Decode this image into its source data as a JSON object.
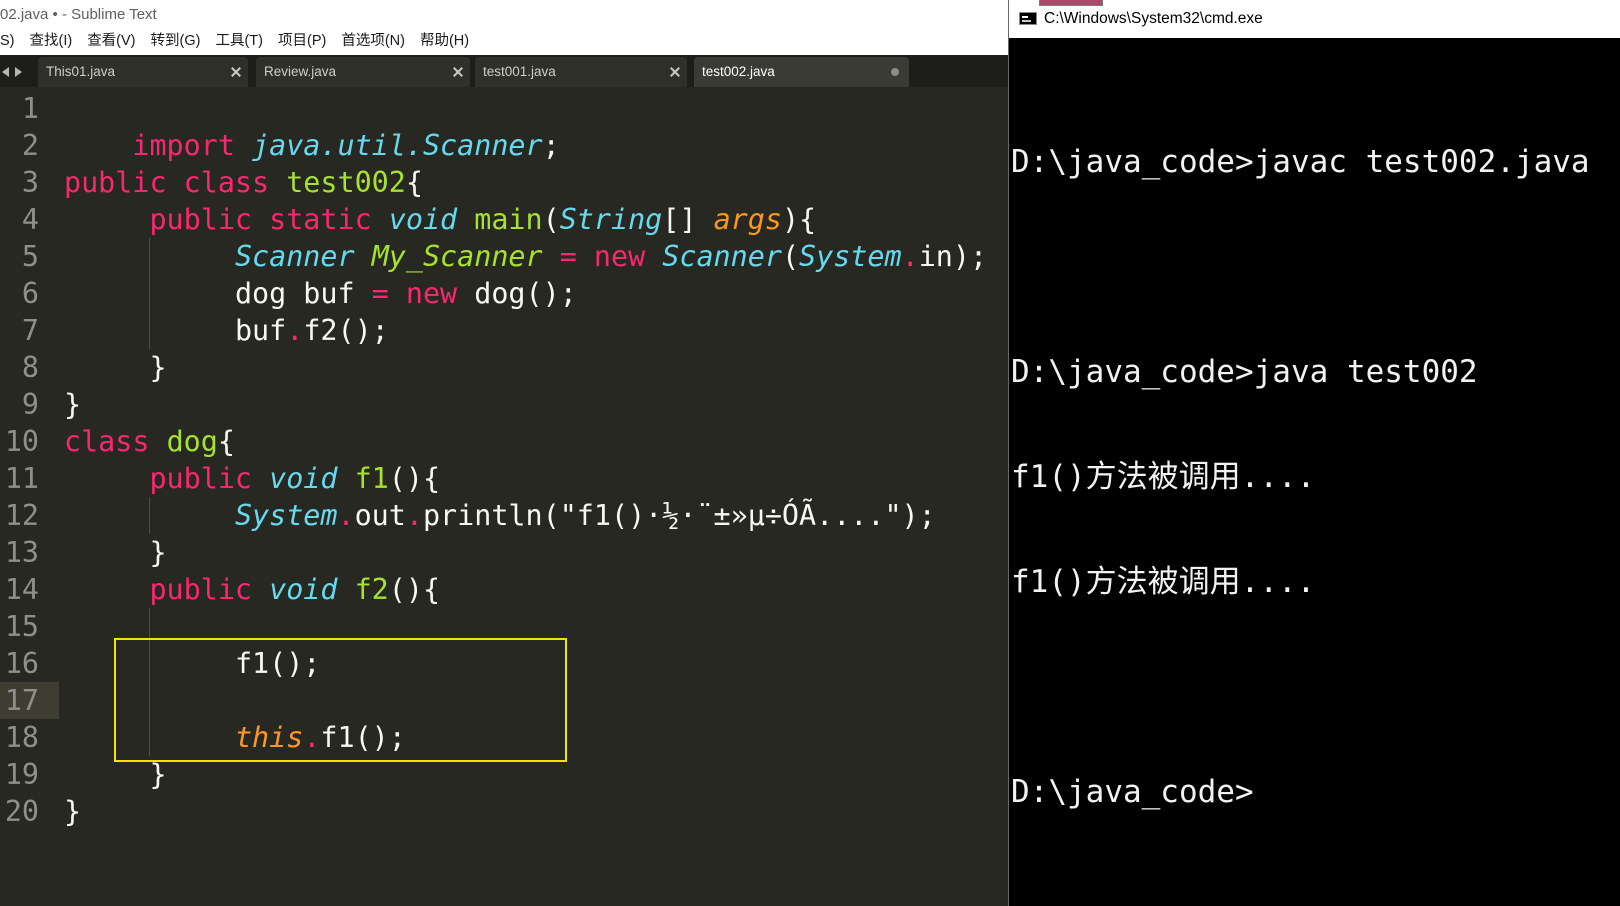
{
  "theme": {
    "keyword": "#F92672",
    "type": "#66D9EF",
    "name": "#A6E22E",
    "param": "#FD971F",
    "text": "#F8F8F2",
    "editor_bg": "#272822",
    "gutter_fg": "#90908A",
    "current_line_bg": "#3E3D32",
    "annotation": "#F2E600",
    "cmd_bg": "#000000",
    "cmd_fg": "#F2F2F2"
  },
  "icons": {
    "tab_scroll_left": "chevron-left-icon",
    "tab_scroll_right": "chevron-right-icon",
    "tab_close": "close-icon",
    "tab_modified": "modified-dot-icon",
    "cmd_app": "cmd-icon"
  },
  "sublime": {
    "title": "02.java • - Sublime Text",
    "menu": [
      "S)",
      "查找(I)",
      "查看(V)",
      "转到(G)",
      "工具(T)",
      "项目(P)",
      "首选项(N)",
      "帮助(H)"
    ],
    "tabs": [
      {
        "label": "This01.java",
        "active": false,
        "modified": false
      },
      {
        "label": "Review.java",
        "active": false,
        "modified": false
      },
      {
        "label": "test001.java",
        "active": false,
        "modified": false
      },
      {
        "label": "test002.java",
        "active": true,
        "modified": true
      }
    ]
  },
  "editor": {
    "current_line": 17,
    "lines": [
      {
        "n": 1,
        "indent": "",
        "tokens": []
      },
      {
        "n": 2,
        "indent": "    ",
        "tokens": [
          [
            "kw",
            "import"
          ],
          [
            "",
            " "
          ],
          [
            "ty",
            "java.util.Scanner"
          ],
          [
            "",
            ";"
          ]
        ]
      },
      {
        "n": 3,
        "indent": "",
        "tokens": [
          [
            "kw",
            "public"
          ],
          [
            "",
            " "
          ],
          [
            "kw",
            "class"
          ],
          [
            "",
            " "
          ],
          [
            "nm",
            "test002"
          ],
          [
            "",
            "{"
          ]
        ]
      },
      {
        "n": 4,
        "indent": "     ",
        "tokens": [
          [
            "kw",
            "public"
          ],
          [
            "",
            " "
          ],
          [
            "kw",
            "static"
          ],
          [
            "",
            " "
          ],
          [
            "ty",
            "void"
          ],
          [
            "",
            " "
          ],
          [
            "nm",
            "main"
          ],
          [
            "",
            "("
          ],
          [
            "ty",
            "String"
          ],
          [
            "",
            "[] "
          ],
          [
            "pa",
            "args"
          ],
          [
            "",
            "){"
          ]
        ]
      },
      {
        "n": 5,
        "indent": "          ",
        "tokens": [
          [
            "ty",
            "Scanner"
          ],
          [
            "",
            " "
          ],
          [
            "nmi",
            "My_Scanner"
          ],
          [
            "",
            " "
          ],
          [
            "kw",
            "="
          ],
          [
            "",
            " "
          ],
          [
            "kw",
            "new"
          ],
          [
            "",
            " "
          ],
          [
            "ty",
            "Scanner"
          ],
          [
            "",
            "("
          ],
          [
            "ty",
            "System"
          ],
          [
            "kw",
            "."
          ],
          [
            "",
            "in);"
          ]
        ]
      },
      {
        "n": 6,
        "indent": "          ",
        "tokens": [
          [
            "",
            "dog buf "
          ],
          [
            "kw",
            "="
          ],
          [
            "",
            " "
          ],
          [
            "kw",
            "new"
          ],
          [
            "",
            " dog();"
          ]
        ]
      },
      {
        "n": 7,
        "indent": "          ",
        "tokens": [
          [
            "",
            "buf"
          ],
          [
            "kw",
            "."
          ],
          [
            "",
            "f2();"
          ]
        ]
      },
      {
        "n": 8,
        "indent": "     ",
        "tokens": [
          [
            "",
            "}"
          ]
        ]
      },
      {
        "n": 9,
        "indent": "",
        "tokens": [
          [
            "",
            "}"
          ]
        ]
      },
      {
        "n": 10,
        "indent": "",
        "tokens": [
          [
            "kw",
            "class"
          ],
          [
            "",
            " "
          ],
          [
            "nm",
            "dog"
          ],
          [
            "",
            "{"
          ]
        ]
      },
      {
        "n": 11,
        "indent": "     ",
        "tokens": [
          [
            "kw",
            "public"
          ],
          [
            "",
            " "
          ],
          [
            "ty",
            "void"
          ],
          [
            "",
            " "
          ],
          [
            "nm",
            "f1"
          ],
          [
            "",
            "(){"
          ]
        ]
      },
      {
        "n": 12,
        "indent": "          ",
        "tokens": [
          [
            "ty",
            "System"
          ],
          [
            "kw",
            "."
          ],
          [
            "",
            "out"
          ],
          [
            "kw",
            "."
          ],
          [
            "",
            "println(\"f1()·½·¨±»µ÷ÓÃ....\");"
          ]
        ]
      },
      {
        "n": 13,
        "indent": "     ",
        "tokens": [
          [
            "",
            "}"
          ]
        ]
      },
      {
        "n": 14,
        "indent": "     ",
        "tokens": [
          [
            "kw",
            "public"
          ],
          [
            "",
            " "
          ],
          [
            "ty",
            "void"
          ],
          [
            "",
            " "
          ],
          [
            "nm",
            "f2"
          ],
          [
            "",
            "(){"
          ]
        ]
      },
      {
        "n": 15,
        "indent": "          ",
        "tokens": []
      },
      {
        "n": 16,
        "indent": "          ",
        "tokens": [
          [
            "",
            "f1();"
          ]
        ]
      },
      {
        "n": 17,
        "indent": "          ",
        "tokens": []
      },
      {
        "n": 18,
        "indent": "          ",
        "tokens": [
          [
            "pa",
            "this"
          ],
          [
            "kw",
            "."
          ],
          [
            "",
            "f1();"
          ]
        ]
      },
      {
        "n": 19,
        "indent": "     ",
        "tokens": [
          [
            "",
            "}"
          ]
        ]
      },
      {
        "n": 20,
        "indent": "",
        "tokens": [
          [
            "",
            "}"
          ]
        ]
      }
    ]
  },
  "cmd": {
    "title": "C:\\Windows\\System32\\cmd.exe",
    "lines": [
      "D:\\java_code>javac test002.java",
      "",
      "D:\\java_code>java test002",
      "f1()方法被调用....",
      "f1()方法被调用....",
      "",
      "D:\\java_code>"
    ]
  }
}
